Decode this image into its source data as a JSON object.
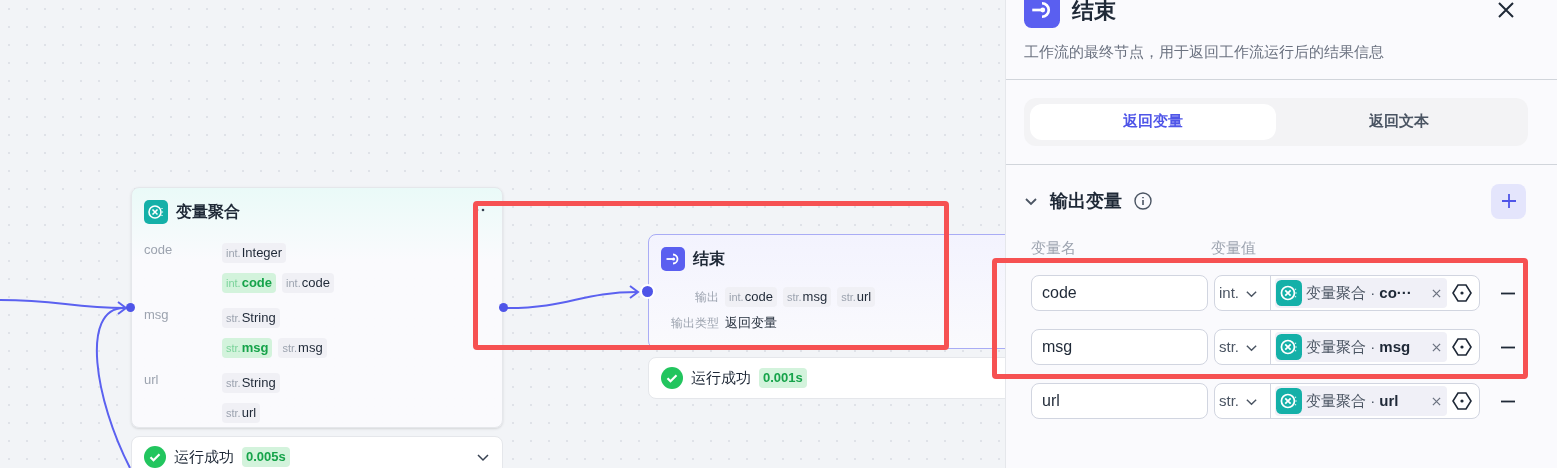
{
  "canvas": {
    "aggregator": {
      "title": "变量聚合",
      "groups": [
        {
          "name": "code",
          "type": {
            "prefix": "int.",
            "label": "Integer"
          },
          "sources": [
            {
              "prefix": "int.",
              "label": "code",
              "highlighted": true
            },
            {
              "prefix": "int.",
              "label": "code",
              "highlighted": false
            }
          ]
        },
        {
          "name": "msg",
          "type": {
            "prefix": "str.",
            "label": "String"
          },
          "sources": [
            {
              "prefix": "str.",
              "label": "msg",
              "highlighted": true
            },
            {
              "prefix": "str.",
              "label": "msg",
              "highlighted": false
            }
          ]
        },
        {
          "name": "url",
          "type": {
            "prefix": "str.",
            "label": "String"
          },
          "sources": [
            {
              "prefix": "str.",
              "label": "url",
              "highlighted": false
            }
          ]
        }
      ],
      "status": {
        "text": "运行成功",
        "time": "0.005s",
        "collapsible": true
      }
    },
    "end": {
      "title": "结束",
      "outputs_label": "输出",
      "outputs": [
        {
          "prefix": "int.",
          "label": "code"
        },
        {
          "prefix": "str.",
          "label": "msg"
        },
        {
          "prefix": "str.",
          "label": "url"
        }
      ],
      "type_label": "输出类型",
      "type_value": "返回变量",
      "status": {
        "text": "运行成功",
        "time": "0.001s",
        "collapsible": false
      }
    }
  },
  "panel": {
    "title": "结束",
    "description": "工作流的最终节点，用于返回工作流运行后的结果信息",
    "tabs": [
      {
        "label": "返回变量",
        "selected": true
      },
      {
        "label": "返回文本",
        "selected": false
      }
    ],
    "section": {
      "title": "输出变量",
      "expanded": true
    },
    "columns": [
      "变量名",
      "变量值"
    ],
    "rows": [
      {
        "name": "code",
        "type": "int.",
        "source": "变量聚合 · **co···**"
      },
      {
        "name": "msg",
        "type": "str.",
        "source": "变量聚合 · **msg**"
      },
      {
        "name": "url",
        "type": "str.",
        "source": "变量聚合 · **url**"
      }
    ]
  },
  "highlights": [
    {
      "kind": "frame"
    },
    {
      "kind": "frame"
    }
  ]
}
